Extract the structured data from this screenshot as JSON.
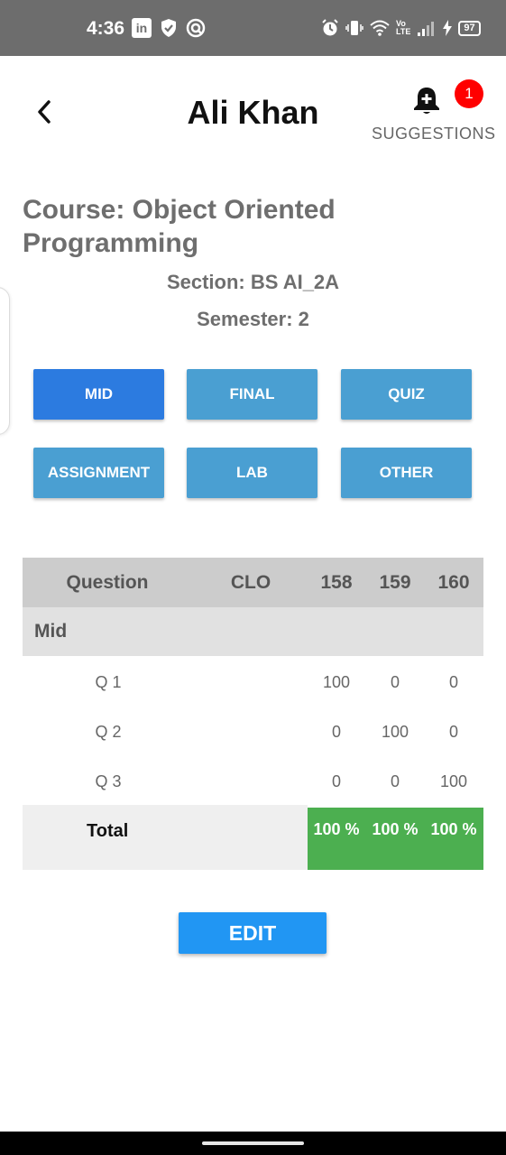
{
  "status_bar": {
    "time": "4:36",
    "linkedin_label": "in",
    "volte_label": "Vo\nLTE",
    "battery": "97"
  },
  "header": {
    "title": "Ali Khan",
    "suggestions_label": "SUGGESTIONS",
    "notification_count": "1"
  },
  "course": {
    "course_text": "Course: Object Oriented Programming",
    "section_text": "Section: BS AI_2A",
    "semester_text": "Semester: 2"
  },
  "tabs": [
    {
      "label": "MID",
      "active": true
    },
    {
      "label": "FINAL",
      "active": false
    },
    {
      "label": "QUIZ",
      "active": false
    },
    {
      "label": "ASSIGNMENT",
      "active": false
    },
    {
      "label": "LAB",
      "active": false
    },
    {
      "label": "OTHER",
      "active": false
    }
  ],
  "table": {
    "headers": [
      "Question",
      "CLO",
      "158",
      "159",
      "160"
    ],
    "group_label": "Mid",
    "rows": [
      {
        "question": "Q 1",
        "clo": "",
        "v1": "100",
        "v2": "0",
        "v3": "0"
      },
      {
        "question": "Q 2",
        "clo": "",
        "v1": "0",
        "v2": "100",
        "v3": "0"
      },
      {
        "question": "Q 3",
        "clo": "",
        "v1": "0",
        "v2": "0",
        "v3": "100"
      }
    ],
    "total_label": "Total",
    "totals": [
      "100 %",
      "100 %",
      "100 %"
    ]
  },
  "edit_label": "EDIT",
  "colors": {
    "active_tab": "#2c7be0",
    "tab": "#4a9fd2",
    "total_bg": "#4caf50",
    "edit_button": "#2196f3",
    "badge": "#ff0000"
  }
}
